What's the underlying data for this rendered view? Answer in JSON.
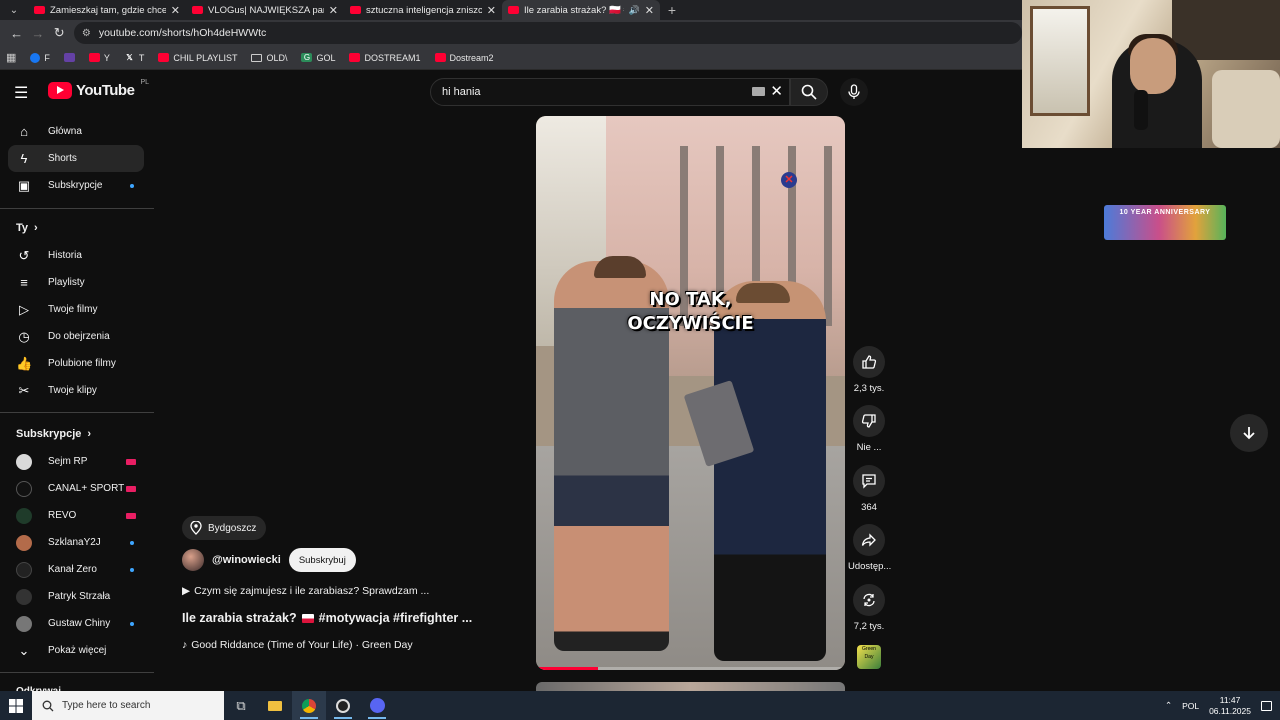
{
  "browser": {
    "tabs": [
      {
        "title": "Zamieszkaj tam, gdzie chcesz i",
        "active": false,
        "audio": false
      },
      {
        "title": "VLOGus| NAJWIĘKSZA parada",
        "active": false,
        "audio": false
      },
      {
        "title": "sztuczna inteligencja zniszczyła",
        "active": false,
        "audio": false
      },
      {
        "title": "Ile zarabia strażak? 🇵🇱 #mo",
        "active": true,
        "audio": true
      }
    ],
    "url": "youtube.com/shorts/hOh4deHWWtc",
    "bookmarks": [
      {
        "label": "F",
        "icon": "facebook-icon"
      },
      {
        "label": "",
        "icon": "twitch-icon"
      },
      {
        "label": "Y",
        "icon": "youtube-icon"
      },
      {
        "label": "T",
        "icon": "x-icon"
      },
      {
        "label": "CHIL PLAYLIST",
        "icon": "youtube-icon"
      },
      {
        "label": "OLD\\",
        "icon": "folder-icon"
      },
      {
        "label": "GOL",
        "icon": "g-icon"
      },
      {
        "label": "DOSTREAM1",
        "icon": "youtube-icon"
      },
      {
        "label": "Dostream2",
        "icon": "youtube-icon"
      }
    ]
  },
  "youtube": {
    "logo_text": "YouTube",
    "country_code": "PL",
    "search_value": "hi hania",
    "sidebar": {
      "main": [
        {
          "label": "Główna",
          "icon": "home-icon"
        },
        {
          "label": "Shorts",
          "icon": "shorts-icon",
          "active": true
        },
        {
          "label": "Subskrypcje",
          "icon": "subscriptions-icon",
          "dot": true
        }
      ],
      "you_heading": "Ty",
      "you": [
        {
          "label": "Historia",
          "icon": "history-icon"
        },
        {
          "label": "Playlisty",
          "icon": "playlists-icon"
        },
        {
          "label": "Twoje filmy",
          "icon": "your-videos-icon"
        },
        {
          "label": "Do obejrzenia",
          "icon": "watch-later-icon"
        },
        {
          "label": "Polubione filmy",
          "icon": "liked-icon"
        },
        {
          "label": "Twoje klipy",
          "icon": "clips-icon"
        }
      ],
      "subs_heading": "Subskrypcje",
      "subs": [
        {
          "label": "Sejm RP",
          "status": "live",
          "color": "#d9d9d9"
        },
        {
          "label": "CANAL+ SPORT",
          "status": "live",
          "color": "#111111"
        },
        {
          "label": "REVO",
          "status": "live",
          "color": "#1f3b2a"
        },
        {
          "label": "SzklanaY2J",
          "status": "dot",
          "color": "#b36b4a"
        },
        {
          "label": "Kanał Zero",
          "status": "dot",
          "color": "#222222"
        },
        {
          "label": "Patryk Strzała",
          "status": "none",
          "color": "#333333"
        },
        {
          "label": "Gustaw Chiny",
          "status": "dot",
          "color": "#777777"
        }
      ],
      "show_more": "Pokaż więcej",
      "explore_heading": "Odkrywaj"
    },
    "short": {
      "caption_line1": "NO TAK,",
      "caption_line2": "OCZYWIŚCIE",
      "location": "Bydgoszcz",
      "channel": "@winowiecki",
      "subscribe_label": "Subskrybuj",
      "description": "Czym się zajmujesz i ile zarabiasz? Sprawdzam ...",
      "title_part1": "Ile zarabia strażak?",
      "title_part2": "#motywacja #firefighter ...",
      "music": "Good Riddance (Time of Your Life) · Green Day",
      "progress": 0.2,
      "actions": {
        "likes": "2,3 tys.",
        "dislike": "Nie ...",
        "comments": "364",
        "share": "Udostęp...",
        "remix": "7,2 tys."
      },
      "music_thumb_text": "Green Day"
    }
  },
  "overlay": {
    "banner_text": "10 YEAR ANNIVERSARY"
  },
  "taskbar": {
    "search_placeholder": "Type here to search",
    "language": "POL",
    "time": "11:47",
    "date": "06.11.2025"
  },
  "colors": {
    "brand_red": "#ff0033",
    "background": "#0f0f0f",
    "live_pink": "#e91e63",
    "dot_blue": "#3ea6ff"
  }
}
